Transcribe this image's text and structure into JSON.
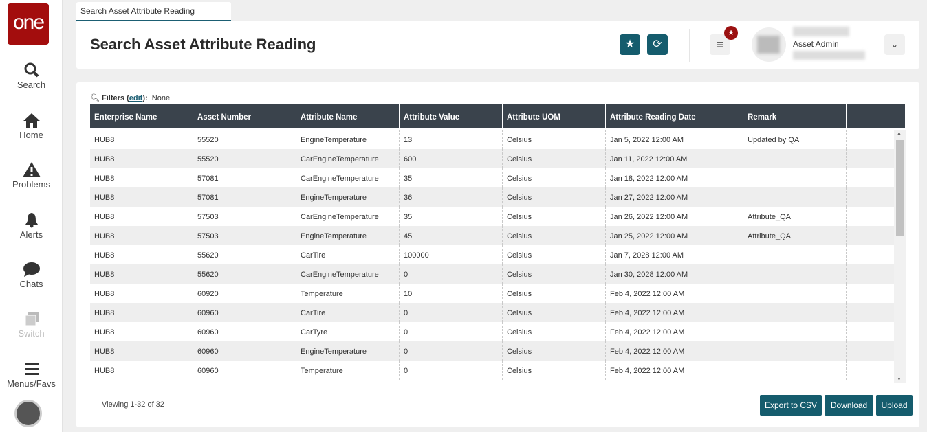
{
  "sidebar": {
    "logo": "one",
    "items": [
      {
        "label": "Search",
        "icon": "search-icon"
      },
      {
        "label": "Home",
        "icon": "home-icon"
      },
      {
        "label": "Problems",
        "icon": "warning-icon"
      },
      {
        "label": "Alerts",
        "icon": "bell-icon"
      },
      {
        "label": "Chats",
        "icon": "chat-icon"
      },
      {
        "label": "Switch",
        "icon": "switch-icon"
      },
      {
        "label": "Menus/Favs",
        "icon": "menu-icon"
      }
    ]
  },
  "tab": {
    "label": "Search Asset Attribute Reading"
  },
  "header": {
    "title": "Search Asset Attribute Reading",
    "user_role": "Asset Admin"
  },
  "filters": {
    "label": "Filters",
    "edit": "edit",
    "suffix": "):",
    "value": "None"
  },
  "table": {
    "columns": [
      "Enterprise Name",
      "Asset Number",
      "Attribute Name",
      "Attribute Value",
      "Attribute UOM",
      "Attribute Reading Date",
      "Remark",
      ""
    ],
    "rows": [
      [
        "HUB8",
        "55520",
        "EngineTemperature",
        "13",
        "Celsius",
        "Jan 5, 2022 12:00 AM",
        "Updated by QA"
      ],
      [
        "HUB8",
        "55520",
        "CarEngineTemperature",
        "600",
        "Celsius",
        "Jan 11, 2022 12:00 AM",
        ""
      ],
      [
        "HUB8",
        "57081",
        "CarEngineTemperature",
        "35",
        "Celsius",
        "Jan 18, 2022 12:00 AM",
        ""
      ],
      [
        "HUB8",
        "57081",
        "EngineTemperature",
        "36",
        "Celsius",
        "Jan 27, 2022 12:00 AM",
        ""
      ],
      [
        "HUB8",
        "57503",
        "CarEngineTemperature",
        "35",
        "Celsius",
        "Jan 26, 2022 12:00 AM",
        "Attribute_QA"
      ],
      [
        "HUB8",
        "57503",
        "EngineTemperature",
        "45",
        "Celsius",
        "Jan 25, 2022 12:00 AM",
        "Attribute_QA"
      ],
      [
        "HUB8",
        "55620",
        "CarTire",
        "100000",
        "Celsius",
        "Jan 7, 2028 12:00 AM",
        ""
      ],
      [
        "HUB8",
        "55620",
        "CarEngineTemperature",
        "0",
        "Celsius",
        "Jan 30, 2028 12:00 AM",
        ""
      ],
      [
        "HUB8",
        "60920",
        "Temperature",
        "10",
        "Celsius",
        "Feb 4, 2022 12:00 AM",
        ""
      ],
      [
        "HUB8",
        "60960",
        "CarTire",
        "0",
        "Celsius",
        "Feb 4, 2022 12:00 AM",
        ""
      ],
      [
        "HUB8",
        "60960",
        "CarTyre",
        "0",
        "Celsius",
        "Feb 4, 2022 12:00 AM",
        ""
      ],
      [
        "HUB8",
        "60960",
        "EngineTemperature",
        "0",
        "Celsius",
        "Feb 4, 2022 12:00 AM",
        ""
      ],
      [
        "HUB8",
        "60960",
        "Temperature",
        "0",
        "Celsius",
        "Feb 4, 2022 12:00 AM",
        ""
      ]
    ]
  },
  "footer": {
    "viewing": "Viewing 1-32 of 32",
    "export": "Export to CSV",
    "download": "Download",
    "upload": "Upload"
  },
  "colors": {
    "accent": "#155c6d",
    "brand": "#a30d0d",
    "header_bg": "#3a434c"
  }
}
